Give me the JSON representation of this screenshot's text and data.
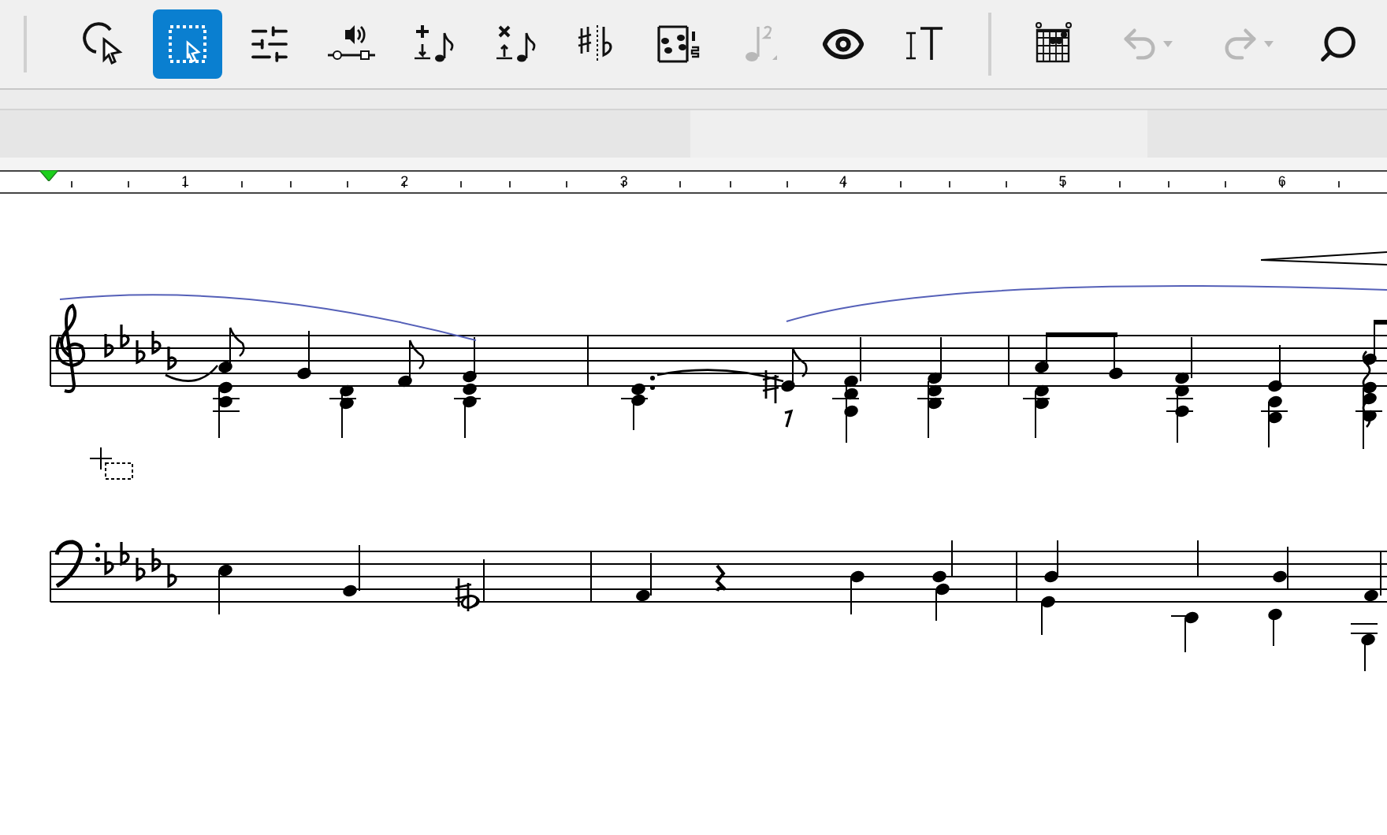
{
  "toolbar": {
    "buttons": [
      {
        "kind": "lasso",
        "selected": false,
        "disabled": false
      },
      {
        "kind": "marquee",
        "selected": true,
        "disabled": false
      },
      {
        "kind": "sliders",
        "selected": false,
        "disabled": false
      },
      {
        "kind": "playback",
        "selected": false,
        "disabled": false
      },
      {
        "kind": "addnote",
        "selected": false,
        "disabled": false
      },
      {
        "kind": "removenote",
        "selected": false,
        "disabled": false
      },
      {
        "kind": "accidentals",
        "selected": false,
        "disabled": false
      },
      {
        "kind": "voices",
        "selected": false,
        "disabled": false
      },
      {
        "kind": "lyric",
        "selected": false,
        "disabled": true
      },
      {
        "kind": "view",
        "selected": false,
        "disabled": false
      },
      {
        "kind": "text",
        "selected": false,
        "disabled": false
      },
      {
        "kind": "separator"
      },
      {
        "kind": "chord",
        "selected": false,
        "disabled": false
      },
      {
        "kind": "undo",
        "selected": false,
        "disabled": true
      },
      {
        "kind": "redo",
        "selected": false,
        "disabled": true
      },
      {
        "kind": "zoom",
        "selected": false,
        "disabled": false
      }
    ]
  },
  "ruler": {
    "labels": [
      "1",
      "2",
      "3",
      "4",
      "5",
      "6"
    ]
  }
}
